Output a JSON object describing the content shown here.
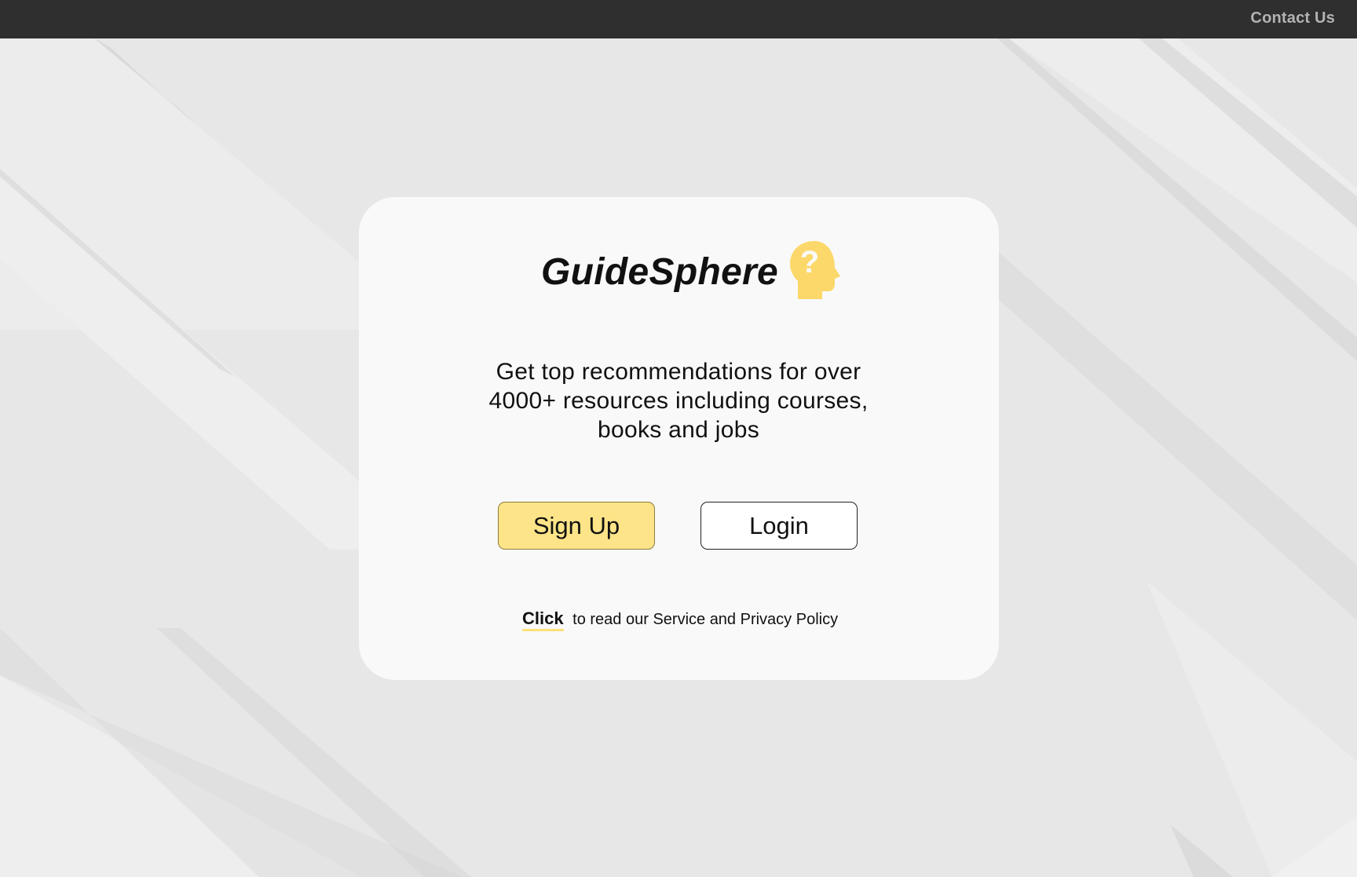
{
  "header": {
    "contact_label": "Contact Us"
  },
  "card": {
    "brand_name": "GuideSphere",
    "brand_icon": "head-question-icon",
    "tagline": "Get top recommendations for over 4000+ resources including courses, books and jobs",
    "signup_label": "Sign Up",
    "login_label": "Login",
    "policy_link_label": "Click",
    "policy_text": "to read our Service and Privacy Policy"
  },
  "colors": {
    "topbar": "#2f2f2f",
    "accent_yellow": "#fde488",
    "icon_yellow": "#fcd86a",
    "card_bg": "#f9f9f9",
    "page_bg": "#e6e6e6"
  }
}
